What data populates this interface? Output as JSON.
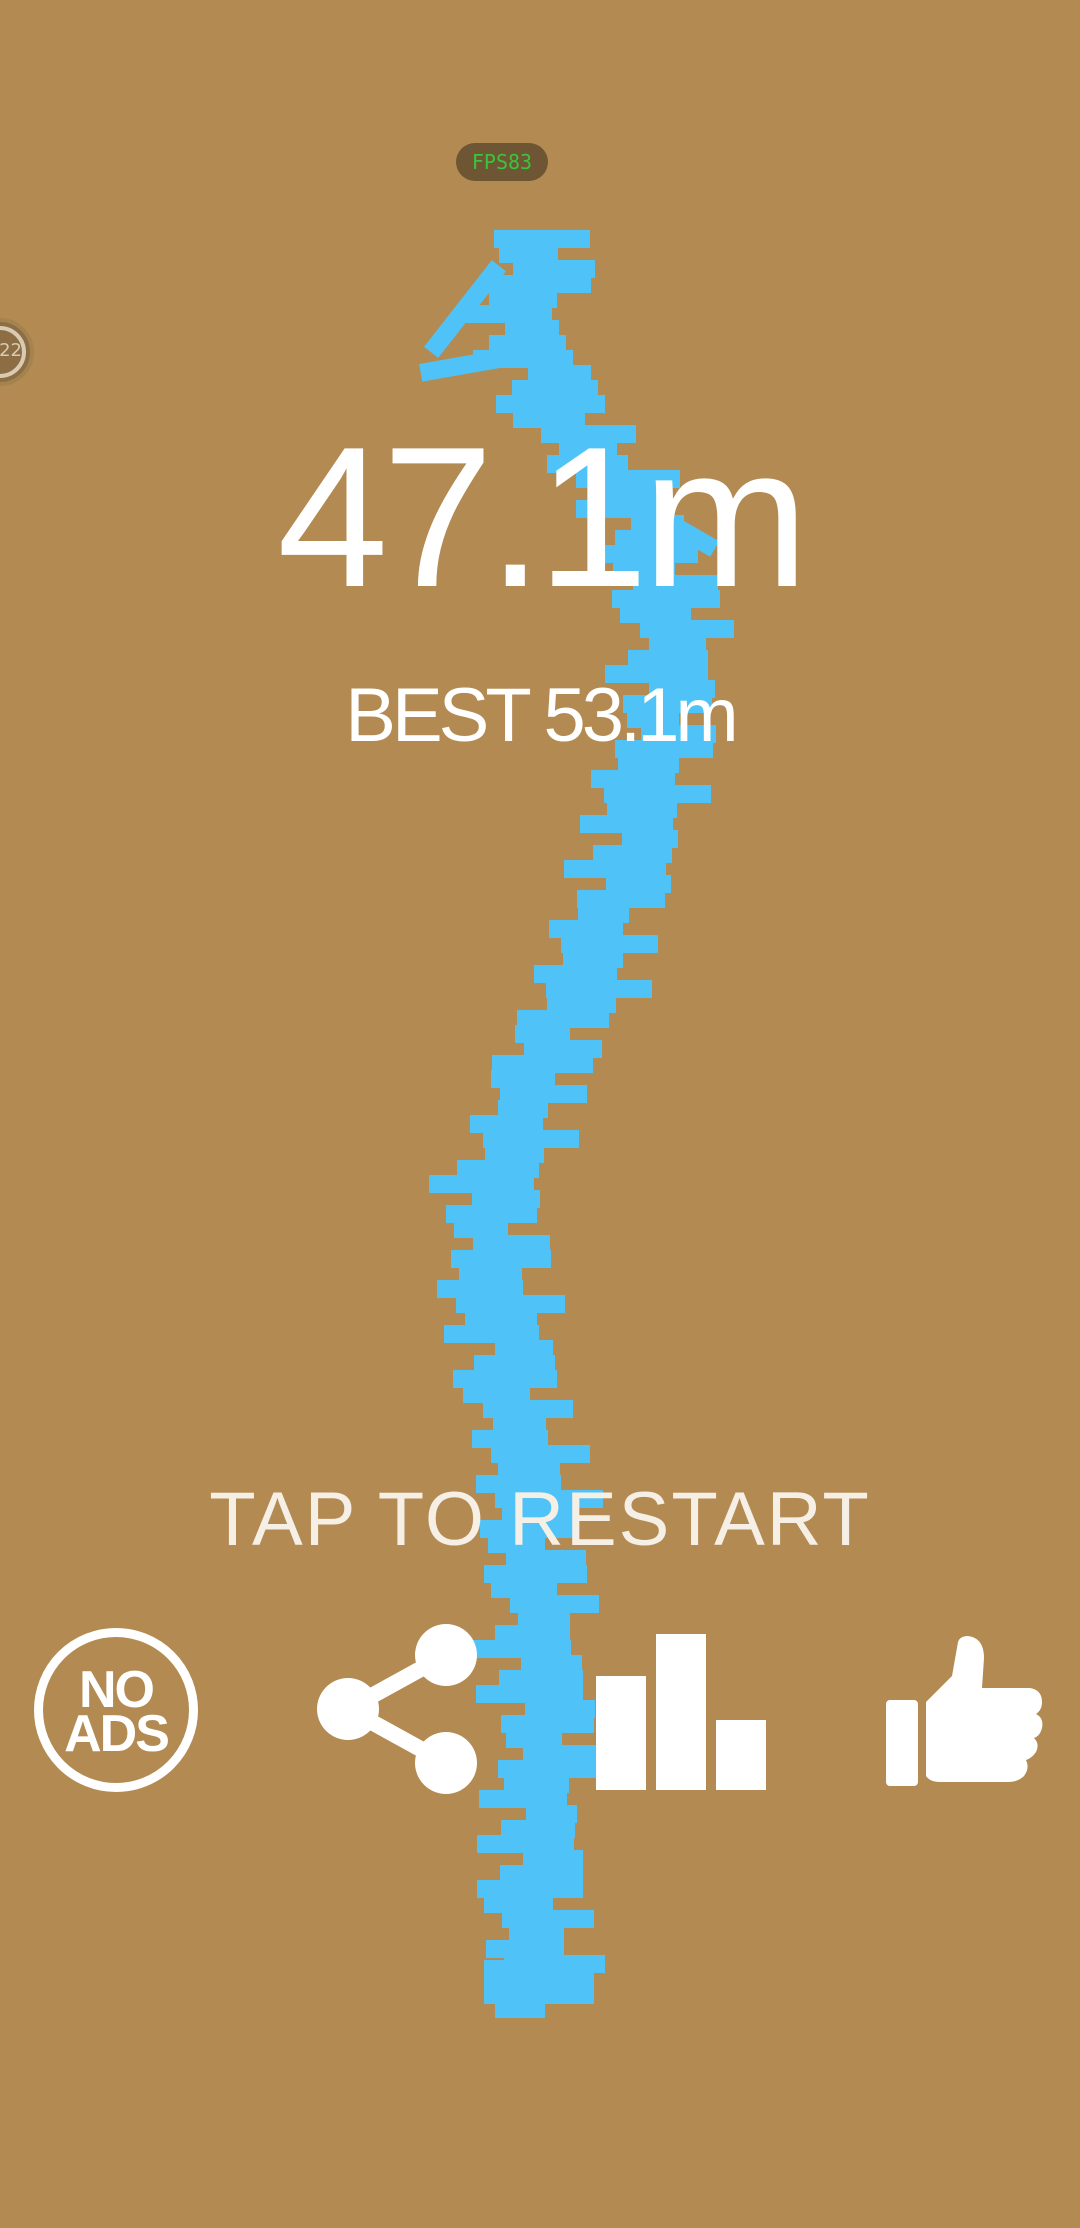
{
  "game": {
    "fps": "FPS83",
    "side_badge": "22",
    "score": "47.1m",
    "best": "BEST 53.1m",
    "restart": "TAP TO RESTART"
  },
  "buttons": {
    "no_ads_line1": "NO",
    "no_ads_line2": "ADS"
  },
  "icons": [
    "share-icon",
    "leaderboard-icon",
    "thumbs-up-icon"
  ],
  "colors": {
    "background": "#B38A51",
    "block": "#4FC3F7",
    "text": "#FFFFFF",
    "fps_text": "#3BC43B"
  }
}
